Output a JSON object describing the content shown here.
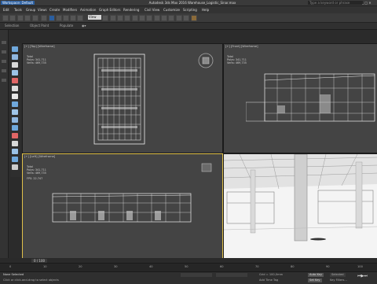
{
  "titlebar": {
    "workspace": "Workspace: Default",
    "title": "Autodesk 3ds Max 2016     Warehouse_Logistic_Sinar.max",
    "search_placeholder": "Type a keyword or phrase",
    "window_controls": "_ □ ✕"
  },
  "menubar": {
    "items": [
      "Edit",
      "Tools",
      "Group",
      "Views",
      "Create",
      "Modifiers",
      "Animation",
      "Graph Editors",
      "Rendering",
      "Civil View",
      "Customize",
      "Scripting",
      "Help"
    ]
  },
  "toolbar": {
    "view_dropdown": "View"
  },
  "ribbon": {
    "items": [
      "Selection",
      "Object Paint",
      "Populate"
    ]
  },
  "viewports": {
    "top": {
      "header": "[+] [Top] [Wireframe]",
      "stats": {
        "total_label": "Total",
        "polys": "Polys:  341,711",
        "verts": "Verts:  469,735"
      }
    },
    "front": {
      "header": "[+] [Front] [Wireframe]",
      "stats": {
        "total_label": "Total",
        "polys": "Polys:  341,711",
        "verts": "Verts:  469,735"
      }
    },
    "left": {
      "header": "[+] [Left] [Wireframe]",
      "stats": {
        "total_label": "Total",
        "polys": "Polys:  341,711",
        "verts": "Verts:  469,735",
        "fps": "FPS:      22.747"
      }
    },
    "perspective": {
      "header": ""
    }
  },
  "timeline": {
    "frame_counter": "0 / 100",
    "ticks": [
      "0",
      "10",
      "20",
      "30",
      "40",
      "50",
      "60",
      "70",
      "80",
      "90",
      "100"
    ]
  },
  "status": {
    "selection": "None Selected",
    "prompt": "Click or click-and-drag to select objects",
    "grid": "Grid = 100,0mm",
    "add_time_tag": "Add Time Tag",
    "auto_key": "Auto Key",
    "set_key": "Set Key",
    "key_filters": "Key Filters...",
    "selected": "Selected"
  },
  "colors": {
    "accent_blue": "#2a5ea0",
    "viewport_bg": "#444444",
    "active_viewport_border": "#e0c14a",
    "wire_white": "#f0f0f0"
  }
}
